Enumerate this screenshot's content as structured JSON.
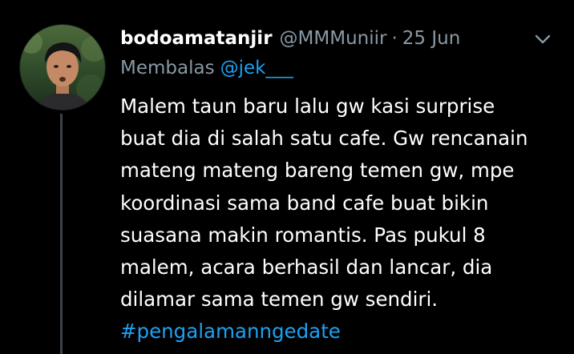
{
  "tweet": {
    "display_name": "bodoamatanjir",
    "handle": "@MMMuniir",
    "separator": "·",
    "date": "25 Jun",
    "reply_prefix": "Membalas",
    "reply_to": "@jek___",
    "body_lines": [
      "Malem taun baru lalu gw kasi surprise",
      "buat dia di salah satu cafe. Gw rencanain",
      "mateng mateng bareng temen gw, mpe",
      "koordinasi sama band cafe buat bikin",
      "suasana makin romantis. Pas pukul 8",
      "malem, acara berhasil dan lancar, dia",
      "dilamar sama temen gw sendiri."
    ],
    "hashtag": "#pengalamanngedate"
  },
  "icons": {
    "more": "chevron-down-icon"
  },
  "colors": {
    "background": "#000000",
    "text": "#ffffff",
    "secondary": "#8899a6",
    "link": "#1da1f2",
    "thread_line": "#3d4247"
  }
}
